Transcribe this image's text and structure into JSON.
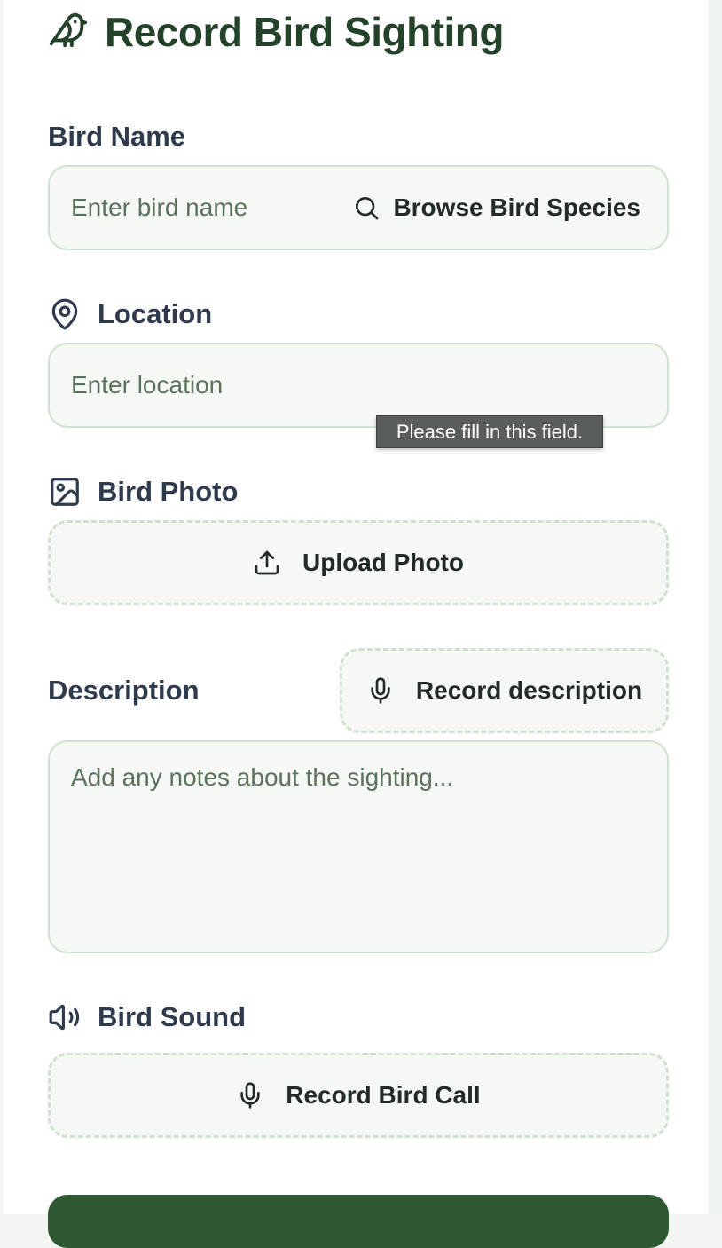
{
  "header": {
    "title": "Record Bird Sighting",
    "icon": "bird-icon"
  },
  "form": {
    "bird_name": {
      "label": "Bird Name",
      "placeholder": "Enter bird name",
      "browse_label": "Browse Bird Species",
      "browse_icon": "search-icon"
    },
    "location": {
      "label": "Location",
      "icon": "map-pin-icon",
      "placeholder": "Enter location",
      "validation_tooltip": "Please fill in this field."
    },
    "photo": {
      "label": "Bird Photo",
      "icon": "image-icon",
      "upload_label": "Upload Photo",
      "upload_icon": "upload-icon"
    },
    "description": {
      "label": "Description",
      "record_label": "Record description",
      "record_icon": "microphone-icon",
      "placeholder": "Add any notes about the sighting..."
    },
    "sound": {
      "label": "Bird Sound",
      "icon": "speaker-icon",
      "record_label": "Record Bird Call",
      "record_icon": "microphone-icon"
    }
  },
  "colors": {
    "title": "#24412a",
    "label": "#2f3b4d",
    "field_bg": "#f6f8f5",
    "field_border": "#cfe2cf",
    "placeholder": "#5b735d",
    "primary": "#2f5a31"
  }
}
